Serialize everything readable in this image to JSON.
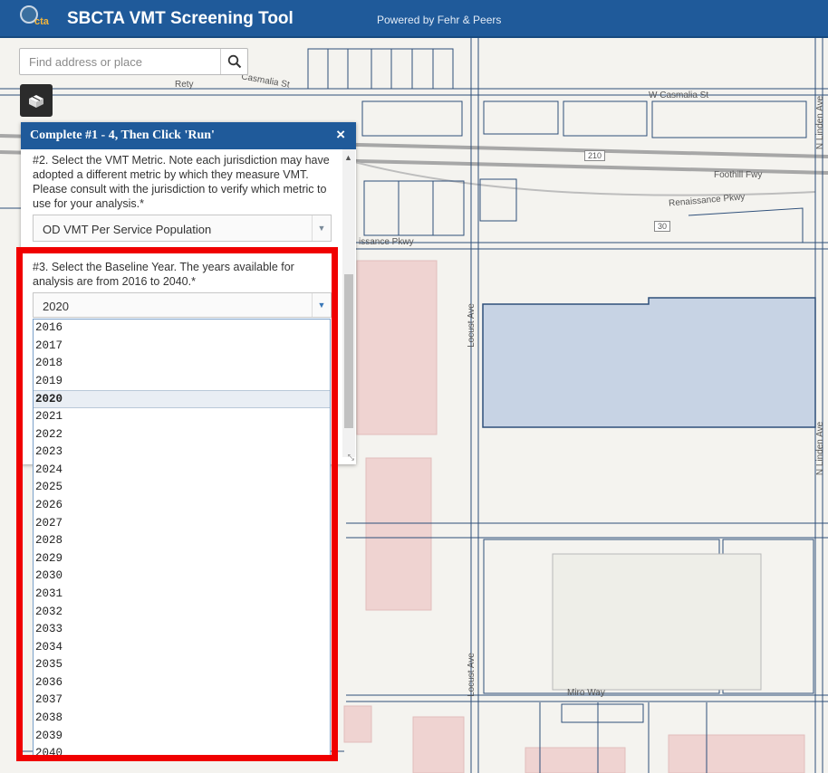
{
  "header": {
    "logo_text": "cta",
    "title": "SBCTA VMT Screening Tool",
    "powered_by": "Powered by Fehr & Peers"
  },
  "search": {
    "placeholder": "Find address or place"
  },
  "map": {
    "streets": {
      "retry": "Rety",
      "casmalia_st": "Casmalia St",
      "w_casmalia_st": "W Casmalia St",
      "route_210": "210",
      "foothill_fwy": "Foothill Fwy",
      "renaissance_pkwy": "Renaissance Pkwy",
      "route_30": "30",
      "renaissance_pkwy_left": "issance Pkwy",
      "locust_ave": "Locust Ave",
      "n_linden_ave": "N Linden Ave",
      "miro_way": "Miro Way"
    }
  },
  "panel": {
    "title": "Complete #1 - 4, Then Click 'Run'",
    "close_label": "×",
    "q2_text": "#2. Select the VMT Metric. Note each jurisdiction may have adopted a different metric by which they measure VMT. Please consult with the jurisdiction to verify which metric to use for your analysis.*",
    "metric_value": "OD VMT Per Service Population",
    "q3_text": "#3. Select the Baseline Year. The years available for analysis are from 2016 to 2040.*",
    "year_value": "2020"
  },
  "year_options": [
    "2016",
    "2017",
    "2018",
    "2019",
    "2020",
    "2021",
    "2022",
    "2023",
    "2024",
    "2025",
    "2026",
    "2027",
    "2028",
    "2029",
    "2030",
    "2031",
    "2032",
    "2033",
    "2034",
    "2035",
    "2036",
    "2037",
    "2038",
    "2039",
    "2040"
  ],
  "colors": {
    "header_blue": "#1f5a9a",
    "highlight_red": "#f00000",
    "parcel_blue_fill": "#c7d3e4",
    "building_pink": "#efd3d1"
  }
}
